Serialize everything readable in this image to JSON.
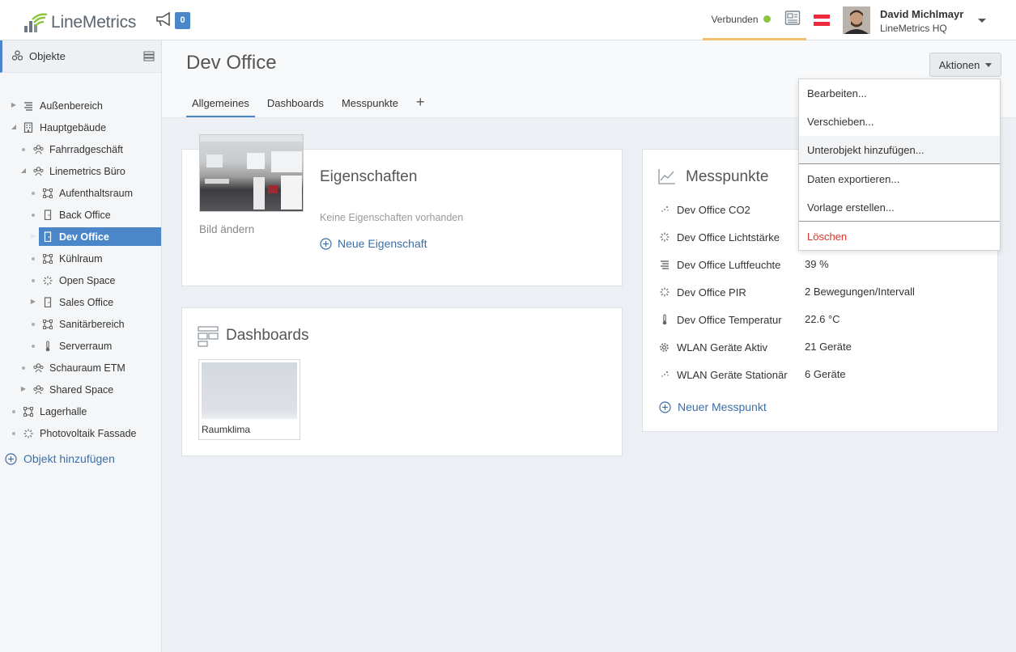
{
  "header": {
    "logo_text": "LineMetrics",
    "notification_count": "0",
    "connection_status": "Verbunden",
    "user_name": "David Michlmayr",
    "user_company": "LineMetrics HQ",
    "colors": {
      "accent": "#4a86c8",
      "connected": "#8cc63f",
      "highlight": "#f2c26b"
    }
  },
  "sidebar": {
    "title": "Objekte",
    "add_label": "Objekt hinzufügen",
    "items": [
      {
        "label": "Außenbereich",
        "icon": "bars-icon",
        "expander": "collapsed"
      },
      {
        "label": "Hauptgebäude",
        "icon": "building-icon",
        "expander": "expanded"
      },
      {
        "label": "Fahrradgeschäft",
        "icon": "group-icon",
        "expander": "none"
      },
      {
        "label": "Linemetrics Büro",
        "icon": "group-icon",
        "expander": "expanded"
      },
      {
        "label": "Aufenthaltsraum",
        "icon": "room-icon",
        "expander": "none"
      },
      {
        "label": "Back Office",
        "icon": "door-icon",
        "expander": "none"
      },
      {
        "label": "Dev Office",
        "icon": "door-icon",
        "expander": "collapsed",
        "selected": true
      },
      {
        "label": "Kühlraum",
        "icon": "room-icon",
        "expander": "none"
      },
      {
        "label": "Open Space",
        "icon": "spinner-icon",
        "expander": "none"
      },
      {
        "label": "Sales Office",
        "icon": "door-icon",
        "expander": "collapsed"
      },
      {
        "label": "Sanitärbereich",
        "icon": "room-icon",
        "expander": "none"
      },
      {
        "label": "Serverraum",
        "icon": "thermometer-icon",
        "expander": "none"
      },
      {
        "label": "Schauraum ETM",
        "icon": "group-icon",
        "expander": "none"
      },
      {
        "label": "Shared Space",
        "icon": "group-icon",
        "expander": "collapsed"
      },
      {
        "label": "Lagerhalle",
        "icon": "room-icon",
        "expander": "none"
      },
      {
        "label": "Photovoltaik Fassade",
        "icon": "spinner-icon",
        "expander": "none"
      }
    ]
  },
  "main": {
    "title": "Dev Office",
    "tabs": [
      {
        "label": "Allgemeines",
        "active": true
      },
      {
        "label": "Dashboards"
      },
      {
        "label": "Messpunkte"
      },
      {
        "label": "+"
      }
    ],
    "actions_label": "Aktionen",
    "properties": {
      "change_image": "Bild ändern",
      "title": "Eigenschaften",
      "empty_text": "Keine Eigenschaften vorhanden",
      "add_label": "Neue Eigenschaft"
    },
    "dashboards": {
      "title": "Dashboards",
      "items": [
        {
          "label": "Raumklima"
        }
      ]
    },
    "measurements": {
      "title": "Messpunkte",
      "add_label": "Neuer Messpunkt",
      "rows": [
        {
          "label": "Dev Office CO2",
          "value": "",
          "icon": "dots-icon"
        },
        {
          "label": "Dev Office Lichtstärke",
          "value": "",
          "icon": "spinner-icon"
        },
        {
          "label": "Dev Office Luftfeuchte",
          "value": "39 %",
          "icon": "bars-icon"
        },
        {
          "label": "Dev Office PIR",
          "value": "2 Bewegungen/Intervall",
          "icon": "spinner-icon"
        },
        {
          "label": "Dev Office Temperatur",
          "value": "22.6 °C",
          "icon": "thermometer-icon"
        },
        {
          "label": "WLAN Geräte Aktiv",
          "value": "21 Geräte",
          "icon": "gear-icon"
        },
        {
          "label": "WLAN Geräte Stationär",
          "value": "6 Geräte",
          "icon": "dots-icon"
        }
      ]
    }
  },
  "actions_menu": {
    "items": [
      {
        "label": "Bearbeiten..."
      },
      {
        "label": "Verschieben..."
      },
      {
        "label": "Unterobjekt hinzufügen...",
        "hover": true
      },
      {
        "label": "Daten exportieren..."
      },
      {
        "label": "Vorlage erstellen..."
      },
      {
        "label": "Löschen",
        "danger": true
      }
    ]
  }
}
